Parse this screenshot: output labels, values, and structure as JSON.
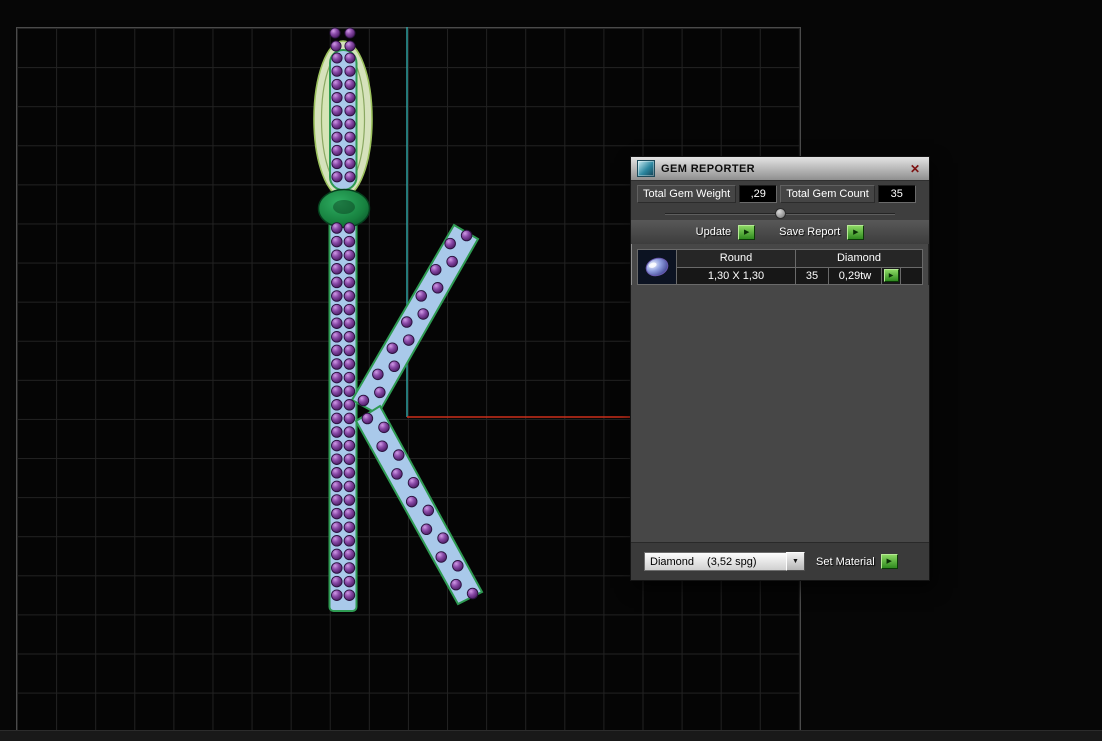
{
  "gem_reporter": {
    "title": "GEM REPORTER",
    "close_glyph": "✕",
    "total_gem_weight": {
      "label": "Total Gem Weight",
      "value": ",29"
    },
    "total_gem_count": {
      "label": "Total Gem Count",
      "value": "35"
    },
    "update_label": "Update",
    "save_report_label": "Save Report",
    "arrow_glyph": "▶",
    "dropdown_glyph": "▼",
    "table": {
      "shape_header": "Round",
      "type_header": "Diamond",
      "size": "1,30 X 1,30",
      "count": "35",
      "weight": "0,29tw"
    },
    "material": {
      "value": "Diamond",
      "detail": "(3,52 spg)"
    },
    "set_material_label": "Set Material"
  },
  "colors": {
    "accent_green": "#2f8a1f",
    "accent_green_light": "#8bd863",
    "gem_purple": "#8a4aa8",
    "metal_pave_blue": "#a9c9ea",
    "metal_outline_green": "#2e9a52",
    "axis_red": "#cd2f1b",
    "axis_cyan": "#2f9f9f",
    "bail_fill": "#e2eec6",
    "ring_green": "#17813f"
  }
}
